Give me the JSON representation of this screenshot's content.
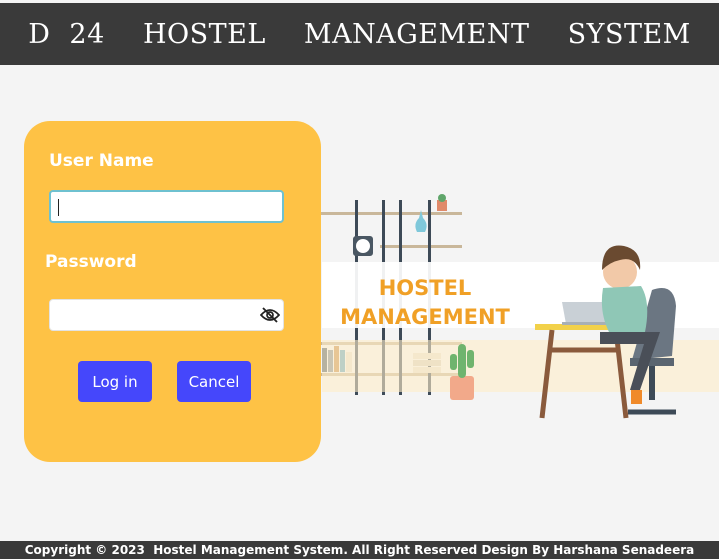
{
  "header": {
    "title": "D 24  HOSTEL  MANAGEMENT  SYSTEM"
  },
  "login": {
    "username_label": "User Name",
    "username_value": "",
    "password_label": "Password",
    "password_value": "",
    "login_button": "Log in",
    "cancel_button": "Cancel",
    "password_toggle_icon": "eye-slash-icon"
  },
  "banner": {
    "line1": "HOSTEL",
    "line2": "MANAGEMENT"
  },
  "footer": {
    "copyright": "Copyright © 2023  Hostel Management System. All Right Reserved Design By Harshana Senadeera"
  },
  "colors": {
    "topbar": "#3a3a3a",
    "card": "#fec245",
    "button": "#4547fb",
    "banner_text": "#f0a026"
  }
}
